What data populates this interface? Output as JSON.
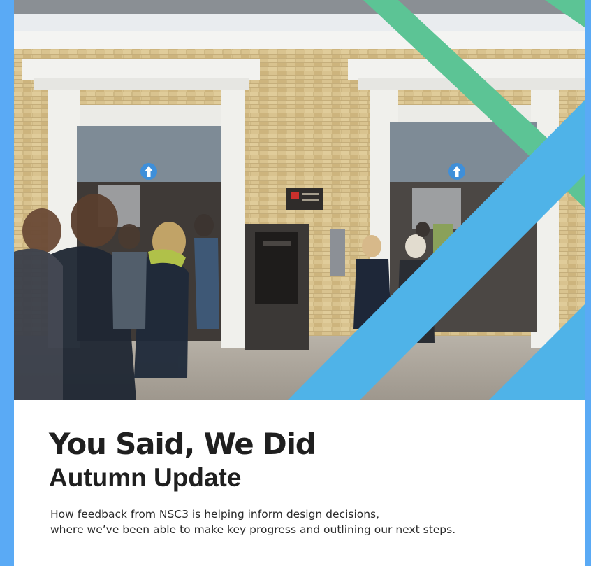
{
  "document": {
    "title": "You Said, We Did",
    "subtitle": "Autumn Update",
    "description_lines": [
      "How feedback from NSC3 is helping inform design decisions,",
      "where we’ve been able to make key progress and outlining our next steps."
    ]
  },
  "colors": {
    "page_frame": "#5aaaf5",
    "green_stripe": "#5cc495",
    "blue_stripe": "#4fb3e8",
    "text": "#1f1f1f"
  },
  "icons": [
    "arrow-up-icon",
    "arrow-up-icon"
  ]
}
